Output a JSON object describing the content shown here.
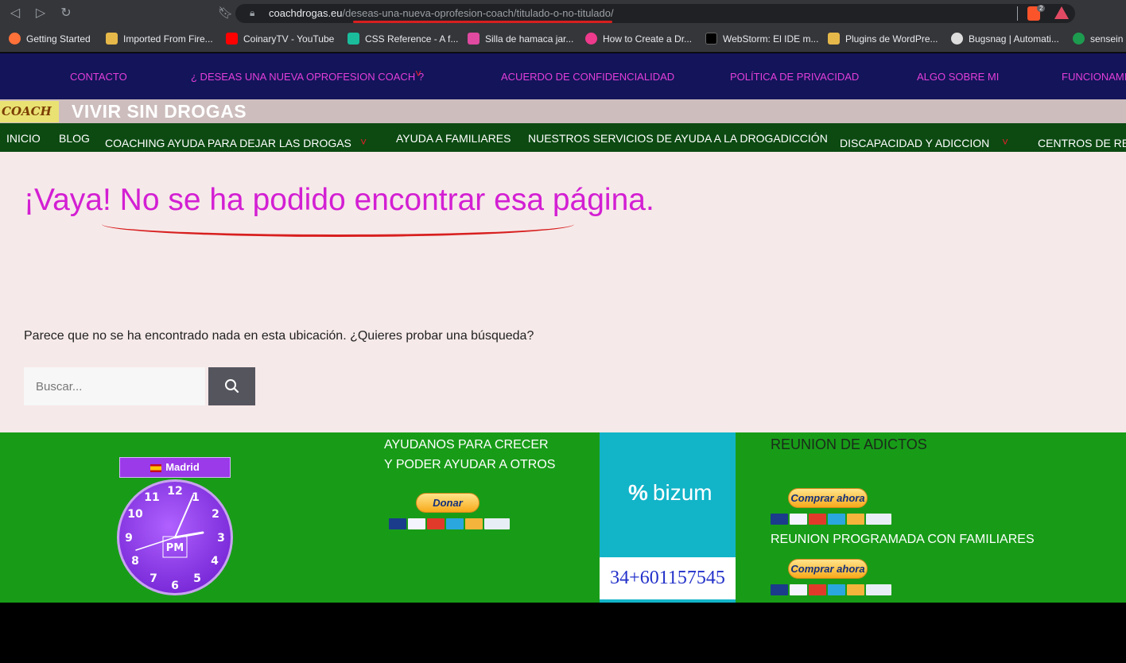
{
  "browser": {
    "url_domain": "coachdrogas.eu",
    "url_path": "/deseas-una-nueva-oprofesion-coach/titulado-o-no-titulado/",
    "brave_badge": "2",
    "bookmarks": [
      {
        "label": "Getting Started",
        "color": "#ff7139"
      },
      {
        "label": "Imported From Fire...",
        "color": "#e6b84a"
      },
      {
        "label": "CoinaryTV - YouTube",
        "color": "#ff0000"
      },
      {
        "label": "CSS Reference - A f...",
        "color": "#1abc9c"
      },
      {
        "label": "Silla de hamaca jar...",
        "color": "#e04aa0"
      },
      {
        "label": "How to Create a Dr...",
        "color": "#ee3a8c"
      },
      {
        "label": "WebStorm: El IDE m...",
        "color": "#000000"
      },
      {
        "label": "Plugins de WordPre...",
        "color": "#e6b84a"
      },
      {
        "label": "Bugsnag | Automati...",
        "color": "#dddddd"
      },
      {
        "label": "sensein",
        "color": "#1d9b4f"
      }
    ]
  },
  "topnav": {
    "items": [
      "CONTACTO",
      "¿ DESEAS UNA NUEVA OPROFESION COACH ?",
      "ACUERDO DE CONFIDENCIALIDAD",
      "POLÍTICA DE PRIVACIDAD",
      "ALGO SOBRE MI",
      "FUNCIONAMI"
    ]
  },
  "header": {
    "logo_text": "COACH J.L",
    "site_title": "VIVIR SIN DROGAS"
  },
  "mainnav": {
    "items": [
      "INICIO",
      "BLOG",
      "COACHING AYUDA PARA DEJAR LAS DROGAS",
      "AYUDA A FAMILIARES",
      "NUESTROS SERVICIOS DE AYUDA A LA DROGADICCIÓN",
      "DISCAPACIDAD Y ADICCION",
      "CENTROS DE REC"
    ]
  },
  "content": {
    "title": "¡Vaya! No se ha podido encontrar esa página.",
    "message": "Parece que no se ha encontrado nada en esta ubicación. ¿Quieres probar una búsqueda?",
    "search_placeholder": "Buscar..."
  },
  "footer": {
    "clock_city": "Madrid",
    "clock_ampm": "PM",
    "help_line1": "AYUDANOS PARA CRECER",
    "help_line2": "Y PODER AYUDAR A OTROS",
    "donate_label": "Donar",
    "bizum_logo": "bizum",
    "bizum_phone": "34+601157545",
    "meet_title": "REUNION DE ADICTOS",
    "buy_label": "Comprar ahora",
    "meet_family": "REUNION PROGRAMADA CON FAMILIARES"
  }
}
